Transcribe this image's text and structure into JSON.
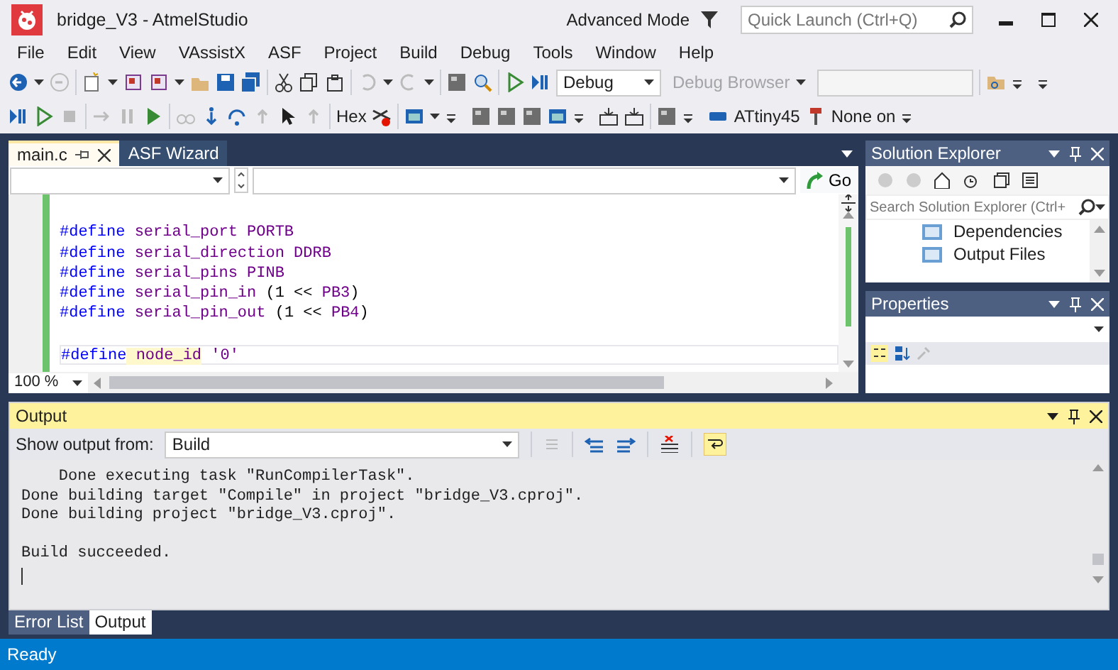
{
  "window": {
    "title": "bridge_V3 - AtmelStudio",
    "mode": "Advanced Mode",
    "quick_launch": {
      "placeholder": "Quick Launch (Ctrl+Q)"
    }
  },
  "menu": [
    "File",
    "Edit",
    "View",
    "VAssistX",
    "ASF",
    "Project",
    "Build",
    "Debug",
    "Tools",
    "Window",
    "Help"
  ],
  "toolbar": {
    "configuration": "Debug",
    "debug_browser": "Debug Browser",
    "hex_button": "Hex",
    "device": "ATtiny45",
    "tool": "None on"
  },
  "editor": {
    "tabs": [
      {
        "label": "main.c",
        "selected": true
      },
      {
        "label": "ASF Wizard",
        "selected": false
      }
    ],
    "go_button": "Go",
    "zoom": "100 %",
    "lines": [
      {
        "gap_before": true,
        "tokens": [
          {
            "text": "#define",
            "kind": "directive"
          },
          {
            "text": " serial_port PORTB",
            "kind": "macro"
          }
        ]
      },
      {
        "tokens": [
          {
            "text": "#define",
            "kind": "directive"
          },
          {
            "text": " serial_direction DDRB",
            "kind": "macro"
          }
        ]
      },
      {
        "tokens": [
          {
            "text": "#define",
            "kind": "directive"
          },
          {
            "text": " serial_pins PINB",
            "kind": "macro"
          }
        ]
      },
      {
        "tokens": [
          {
            "text": "#define",
            "kind": "directive"
          },
          {
            "text": " serial_pin_in",
            "kind": "macro"
          },
          {
            "text": " (1 << ",
            "kind": "plain"
          },
          {
            "text": "PB3",
            "kind": "macro"
          },
          {
            "text": ")",
            "kind": "plain"
          }
        ]
      },
      {
        "tokens": [
          {
            "text": "#define",
            "kind": "directive"
          },
          {
            "text": " serial_pin_out",
            "kind": "macro"
          },
          {
            "text": " (1 << ",
            "kind": "plain"
          },
          {
            "text": "PB4",
            "kind": "macro"
          },
          {
            "text": ")",
            "kind": "plain"
          }
        ]
      },
      {
        "gap_before": true,
        "tokens": [
          {
            "text": "#define",
            "kind": "directive"
          },
          {
            "text": " node_id",
            "kind": "highlight"
          },
          {
            "text": " '0'",
            "kind": "macro"
          }
        ],
        "current": true
      }
    ]
  },
  "solution_explorer": {
    "title": "Solution Explorer",
    "search": {
      "placeholder": "Search Solution Explorer (Ctrl+"
    },
    "items": [
      "Dependencies",
      "Output Files"
    ]
  },
  "properties": {
    "title": "Properties"
  },
  "output": {
    "title": "Output",
    "show_from_label": "Show output from:",
    "source": "Build",
    "lines": [
      {
        "text": "    Done executing task \"RunCompilerTask\"."
      },
      {
        "text": "Done building target \"Compile\" in project \"bridge_V3.cproj\"."
      },
      {
        "text": "Done building project \"bridge_V3.cproj\"."
      },
      {
        "text": "Build succeeded.",
        "gap_before": true
      }
    ],
    "tabs": [
      {
        "label": "Error List",
        "selected": false
      },
      {
        "label": "Output",
        "selected": true
      }
    ]
  },
  "status_bar": "Ready"
}
